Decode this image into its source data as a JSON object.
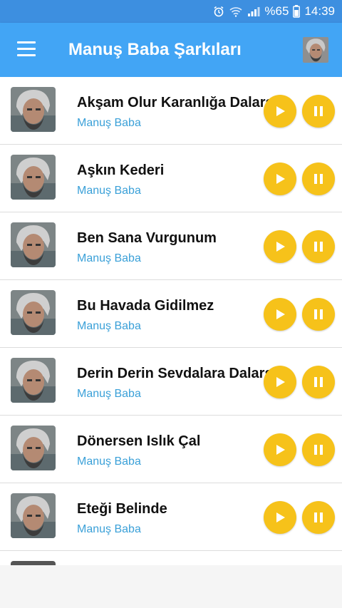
{
  "status_bar": {
    "battery_text": "%65",
    "time": "14:39",
    "icons": [
      "alarm-icon",
      "wifi-icon",
      "signal-icon",
      "battery-icon"
    ]
  },
  "app_bar": {
    "title": "Manuş Baba Şarkıları",
    "menu_icon": "hamburger-menu-icon",
    "avatar": "artist-avatar"
  },
  "colors": {
    "status_bar": "#3d8fe0",
    "app_bar": "#42a5f5",
    "button": "#f6c21a",
    "artist_text": "#3aa0d8"
  },
  "songs": [
    {
      "title": "Akşam Olur Karanlığa Dalarsın",
      "artist": "Manuş Baba"
    },
    {
      "title": "Aşkın Kederi",
      "artist": "Manuş Baba"
    },
    {
      "title": "Ben Sana Vurgunum",
      "artist": "Manuş Baba"
    },
    {
      "title": "Bu Havada Gidilmez",
      "artist": "Manuş Baba"
    },
    {
      "title": "Derin Derin Sevdalara Dalarsın",
      "artist": "Manuş Baba"
    },
    {
      "title": "Dönersen Islık Çal",
      "artist": "Manuş Baba"
    },
    {
      "title": "Eteği Belinde",
      "artist": "Manuş Baba"
    }
  ],
  "controls": {
    "play_icon": "play-icon",
    "pause_icon": "pause-icon"
  }
}
